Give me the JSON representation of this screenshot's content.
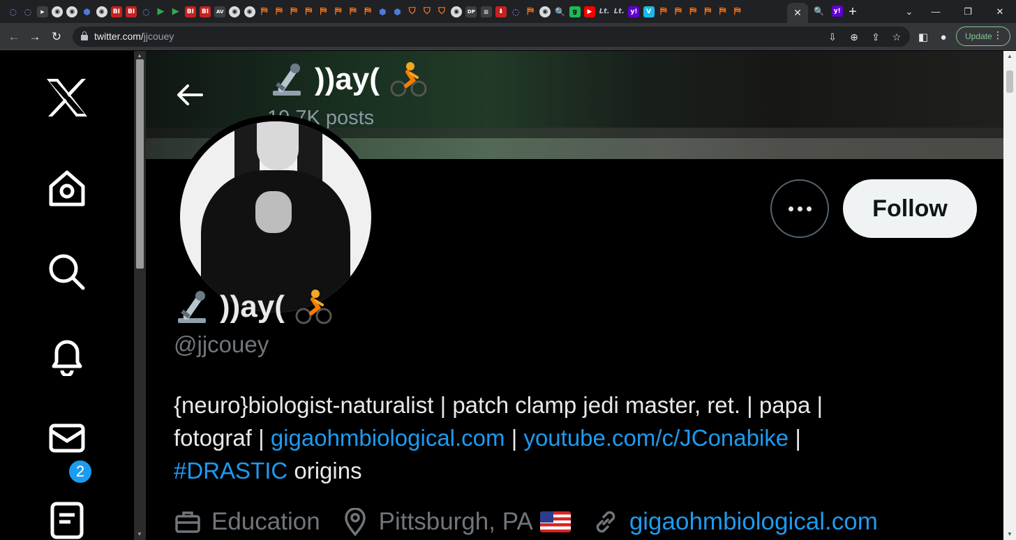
{
  "browser": {
    "url_host": "twitter.com/",
    "url_path": "jjcouey",
    "update_label": "Update",
    "active_tab_close": "✕",
    "new_tab": "+",
    "window_controls": [
      "⌄",
      "—",
      "❐",
      "✕"
    ]
  },
  "favicons": [
    {
      "kind": "shield",
      "glyph": "◌"
    },
    {
      "kind": "shield",
      "glyph": "◌"
    },
    {
      "kind": "dark",
      "glyph": "▶"
    },
    {
      "kind": "circ",
      "glyph": "◉"
    },
    {
      "kind": "circ",
      "glyph": "◉"
    },
    {
      "kind": "hex",
      "glyph": "⬢"
    },
    {
      "kind": "circ",
      "glyph": "◉"
    },
    {
      "kind": "bi",
      "glyph": "BI"
    },
    {
      "kind": "bi",
      "glyph": "BI"
    },
    {
      "kind": "shield",
      "glyph": "◌"
    },
    {
      "kind": "play",
      "glyph": "▶"
    },
    {
      "kind": "play",
      "glyph": "▶"
    },
    {
      "kind": "bi",
      "glyph": "BI"
    },
    {
      "kind": "bi",
      "glyph": "BI"
    },
    {
      "kind": "dark",
      "glyph": "AV"
    },
    {
      "kind": "circ",
      "glyph": "◉"
    },
    {
      "kind": "circ",
      "glyph": "◉"
    },
    {
      "kind": "book",
      "glyph": "⛿"
    },
    {
      "kind": "book",
      "glyph": "⛿"
    },
    {
      "kind": "book",
      "glyph": "⛿"
    },
    {
      "kind": "book",
      "glyph": "⛿"
    },
    {
      "kind": "book",
      "glyph": "⛿"
    },
    {
      "kind": "book",
      "glyph": "⛿"
    },
    {
      "kind": "book",
      "glyph": "⛿"
    },
    {
      "kind": "book",
      "glyph": "⛿"
    },
    {
      "kind": "hex",
      "glyph": "⬢"
    },
    {
      "kind": "hex",
      "glyph": "⬢"
    },
    {
      "kind": "badge",
      "glyph": "⛉"
    },
    {
      "kind": "badge",
      "glyph": "⛉"
    },
    {
      "kind": "badge",
      "glyph": "⛉"
    },
    {
      "kind": "circ",
      "glyph": "◉"
    },
    {
      "kind": "dark",
      "glyph": "DP"
    },
    {
      "kind": "dark",
      "glyph": "▥"
    },
    {
      "kind": "bi",
      "glyph": "⬇"
    },
    {
      "kind": "shield",
      "glyph": "◌"
    },
    {
      "kind": "book",
      "glyph": "⛿"
    },
    {
      "kind": "circ",
      "glyph": "◉"
    },
    {
      "kind": "shield",
      "glyph": "🔍"
    },
    {
      "kind": "g",
      "glyph": "g"
    },
    {
      "kind": "yt",
      "glyph": "▶"
    },
    {
      "kind": "sm",
      "glyph": "Lt."
    },
    {
      "kind": "sm",
      "glyph": "Lt."
    },
    {
      "kind": "yah",
      "glyph": "y!"
    },
    {
      "kind": "vim",
      "glyph": "V"
    },
    {
      "kind": "book",
      "glyph": "⛿"
    },
    {
      "kind": "book",
      "glyph": "⛿"
    },
    {
      "kind": "book",
      "glyph": "⛿"
    },
    {
      "kind": "book",
      "glyph": "⛿"
    },
    {
      "kind": "book",
      "glyph": "⛿"
    },
    {
      "kind": "book",
      "glyph": "⛿"
    }
  ],
  "after_active_favicons": [
    {
      "kind": "shield",
      "glyph": "🔍"
    },
    {
      "kind": "yah",
      "glyph": "y!"
    }
  ],
  "profile": {
    "header_name": "))ay(",
    "header_posts": "19.7K posts",
    "display_name": "))ay(",
    "handle": "@jjcouey",
    "follow_label": "Follow",
    "bio": {
      "line1": "{neuro}biologist-naturalist | patch clamp jedi master, ret. | papa |",
      "l2_text": "fotograf | ",
      "l2_link1": "gigaohmbiological.com",
      "l2_sep": " | ",
      "l2_link2": "youtube.com/c/JConabike",
      "l2_end": " |",
      "l3_tag": "#DRASTIC",
      "l3_text": " origins"
    },
    "meta": {
      "category": "Education",
      "location": "Pittsburgh, PA",
      "website": "gigaohmbiological.com"
    }
  },
  "nav": {
    "notifications_badge": "2"
  },
  "colors": {
    "accent": "#1d9bf0",
    "muted": "#71767b",
    "update_green": "#81c995"
  }
}
